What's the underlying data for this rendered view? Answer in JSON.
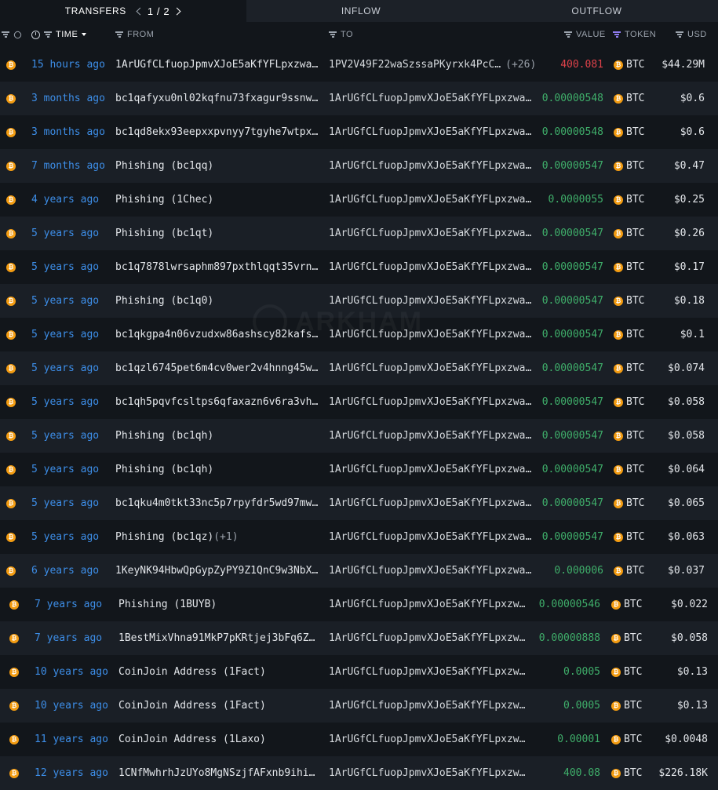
{
  "tabs": {
    "transfers": "TRANSFERS",
    "page_current": "1",
    "page_total": "2",
    "inflow": "INFLOW",
    "outflow": "OUTFLOW"
  },
  "header": {
    "time": "TIME",
    "from": "FROM",
    "to": "TO",
    "value": "VALUE",
    "token": "TOKEN",
    "usd": "USD"
  },
  "colors": {
    "inflow": "#3fae6a",
    "outflow": "#e0424a",
    "time_link": "#3d8ee8",
    "token_filter": "#8f7cf0",
    "btc": "#f39c12"
  },
  "watermark": "ARKHAM",
  "rows": [
    {
      "time": "15 hours ago",
      "from": "1ArUGfCLfuopJpmvXJoE5aKfYFLpxzwa…",
      "from_extra": "",
      "to": "1PV2V49F22waSzssaPKyrxk4PcC…",
      "to_extra": "(+26)",
      "value": "400.081",
      "direction": "out",
      "token": "BTC",
      "usd": "$44.29M"
    },
    {
      "time": "3 months ago",
      "from": "bc1qafyxu0nl02kqfnu73fxagur9ssnw…",
      "from_extra": "",
      "to": "1ArUGfCLfuopJpmvXJoE5aKfYFLpxzwa…",
      "to_extra": "",
      "value": "0.00000548",
      "direction": "in",
      "token": "BTC",
      "usd": "$0.6"
    },
    {
      "time": "3 months ago",
      "from": "bc1qd8ekx93eepxxpvnyy7tgyhe7wtpx…",
      "from_extra": "",
      "to": "1ArUGfCLfuopJpmvXJoE5aKfYFLpxzwa…",
      "to_extra": "",
      "value": "0.00000548",
      "direction": "in",
      "token": "BTC",
      "usd": "$0.6"
    },
    {
      "time": "7 months ago",
      "from": "Phishing (bc1qq)",
      "from_extra": "",
      "to": "1ArUGfCLfuopJpmvXJoE5aKfYFLpxzwa…",
      "to_extra": "",
      "value": "0.00000547",
      "direction": "in",
      "token": "BTC",
      "usd": "$0.47"
    },
    {
      "time": "4 years ago",
      "from": "Phishing (1Chec)",
      "from_extra": "",
      "to": "1ArUGfCLfuopJpmvXJoE5aKfYFLpxzwa…",
      "to_extra": "",
      "value": "0.0000055",
      "direction": "in",
      "token": "BTC",
      "usd": "$0.25"
    },
    {
      "time": "5 years ago",
      "from": "Phishing (bc1qt)",
      "from_extra": "",
      "to": "1ArUGfCLfuopJpmvXJoE5aKfYFLpxzwa…",
      "to_extra": "",
      "value": "0.00000547",
      "direction": "in",
      "token": "BTC",
      "usd": "$0.26"
    },
    {
      "time": "5 years ago",
      "from": "bc1q7878lwrsaphm897pxthlqqt35vrn…",
      "from_extra": "",
      "to": "1ArUGfCLfuopJpmvXJoE5aKfYFLpxzwa…",
      "to_extra": "",
      "value": "0.00000547",
      "direction": "in",
      "token": "BTC",
      "usd": "$0.17"
    },
    {
      "time": "5 years ago",
      "from": "Phishing (bc1q0)",
      "from_extra": "",
      "to": "1ArUGfCLfuopJpmvXJoE5aKfYFLpxzwa…",
      "to_extra": "",
      "value": "0.00000547",
      "direction": "in",
      "token": "BTC",
      "usd": "$0.18"
    },
    {
      "time": "5 years ago",
      "from": "bc1qkgpa4n06vzudxw86ashscy82kafs…",
      "from_extra": "",
      "to": "1ArUGfCLfuopJpmvXJoE5aKfYFLpxzwa…",
      "to_extra": "",
      "value": "0.00000547",
      "direction": "in",
      "token": "BTC",
      "usd": "$0.1"
    },
    {
      "time": "5 years ago",
      "from": "bc1qzl6745pet6m4cv0wer2v4hnng45w…",
      "from_extra": "",
      "to": "1ArUGfCLfuopJpmvXJoE5aKfYFLpxzwa…",
      "to_extra": "",
      "value": "0.00000547",
      "direction": "in",
      "token": "BTC",
      "usd": "$0.074"
    },
    {
      "time": "5 years ago",
      "from": "bc1qh5pqvfcsltps6qfaxazn6v6ra3vh…",
      "from_extra": "",
      "to": "1ArUGfCLfuopJpmvXJoE5aKfYFLpxzwa…",
      "to_extra": "",
      "value": "0.00000547",
      "direction": "in",
      "token": "BTC",
      "usd": "$0.058"
    },
    {
      "time": "5 years ago",
      "from": "Phishing (bc1qh)",
      "from_extra": "",
      "to": "1ArUGfCLfuopJpmvXJoE5aKfYFLpxzwa…",
      "to_extra": "",
      "value": "0.00000547",
      "direction": "in",
      "token": "BTC",
      "usd": "$0.058"
    },
    {
      "time": "5 years ago",
      "from": "Phishing (bc1qh)",
      "from_extra": "",
      "to": "1ArUGfCLfuopJpmvXJoE5aKfYFLpxzwa…",
      "to_extra": "",
      "value": "0.00000547",
      "direction": "in",
      "token": "BTC",
      "usd": "$0.064"
    },
    {
      "time": "5 years ago",
      "from": "bc1qku4m0tkt33nc5p7rpyfdr5wd97mw…",
      "from_extra": "",
      "to": "1ArUGfCLfuopJpmvXJoE5aKfYFLpxzwa…",
      "to_extra": "",
      "value": "0.00000547",
      "direction": "in",
      "token": "BTC",
      "usd": "$0.065"
    },
    {
      "time": "5 years ago",
      "from": "Phishing (bc1qz)",
      "from_extra": "(+1)",
      "to": "1ArUGfCLfuopJpmvXJoE5aKfYFLpxzwa…",
      "to_extra": "",
      "value": "0.00000547",
      "direction": "in",
      "token": "BTC",
      "usd": "$0.063"
    },
    {
      "time": "6 years ago",
      "from": "1KeyNK94HbwQpGypZyPY9Z1QnC9w3NbX…",
      "from_extra": "",
      "to": "1ArUGfCLfuopJpmvXJoE5aKfYFLpxzwa…",
      "to_extra": "",
      "value": "0.000006",
      "direction": "in",
      "token": "BTC",
      "usd": "$0.037"
    },
    {
      "time": "7 years ago",
      "from": "Phishing (1BUYB)",
      "from_extra": "",
      "to": "1ArUGfCLfuopJpmvXJoE5aKfYFLpxzw…",
      "to_extra": "",
      "value": "0.00000546",
      "direction": "in",
      "token": "BTC",
      "usd": "$0.022"
    },
    {
      "time": "7 years ago",
      "from": "1BestMixVhna91MkP7pKRtjej3bFq6Z…",
      "from_extra": "",
      "to": "1ArUGfCLfuopJpmvXJoE5aKfYFLpxzw…",
      "to_extra": "",
      "value": "0.00000888",
      "direction": "in",
      "token": "BTC",
      "usd": "$0.058"
    },
    {
      "time": "10 years ago",
      "from": "CoinJoin Address (1Fact)",
      "from_extra": "",
      "to": "1ArUGfCLfuopJpmvXJoE5aKfYFLpxzw…",
      "to_extra": "",
      "value": "0.0005",
      "direction": "in",
      "token": "BTC",
      "usd": "$0.13"
    },
    {
      "time": "10 years ago",
      "from": "CoinJoin Address (1Fact)",
      "from_extra": "",
      "to": "1ArUGfCLfuopJpmvXJoE5aKfYFLpxzw…",
      "to_extra": "",
      "value": "0.0005",
      "direction": "in",
      "token": "BTC",
      "usd": "$0.13"
    },
    {
      "time": "11 years ago",
      "from": "CoinJoin Address (1Laxo)",
      "from_extra": "",
      "to": "1ArUGfCLfuopJpmvXJoE5aKfYFLpxzw…",
      "to_extra": "",
      "value": "0.00001",
      "direction": "in",
      "token": "BTC",
      "usd": "$0.0048"
    },
    {
      "time": "12 years ago",
      "from": "1CNfMwhrhJzUYo8MgNSzjfAFxnb9ihi…",
      "from_extra": "",
      "to": "1ArUGfCLfuopJpmvXJoE5aKfYFLpxzw…",
      "to_extra": "",
      "value": "400.08",
      "direction": "in",
      "token": "BTC",
      "usd": "$226.18K"
    }
  ]
}
